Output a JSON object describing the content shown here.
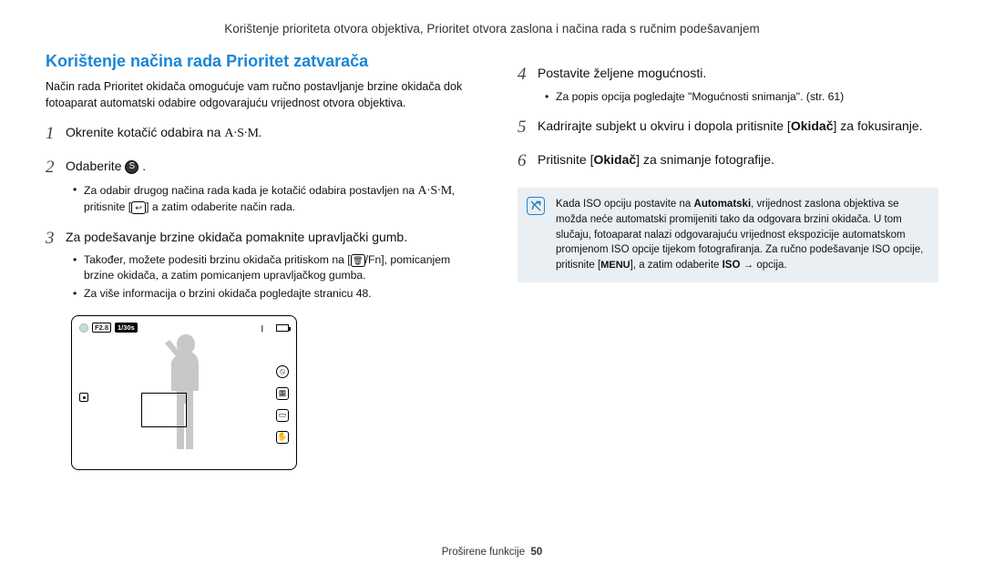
{
  "header": "Korištenje prioriteta otvora objektiva, Prioritet otvora zaslona i načina rada s ručnim podešavanjem",
  "section_title": "Korištenje načina rada Prioritet zatvarača",
  "intro": "Način rada Prioritet okidača omogućuje vam ručno postavljanje brzine okidača dok fotoaparat automatski odabire odgovarajuću vrijednost otvora objektiva.",
  "steps": {
    "s1_num": "1",
    "s1_text_a": "Okrenite kotačić odabira na ",
    "s1_mode": "A·S·M",
    "s1_text_b": ".",
    "s2_num": "2",
    "s2_text_a": "Odaberite ",
    "s2_icon_name": "s-mode-icon",
    "s2_text_b": ".",
    "s2_bullet_a": "Za odabir drugog načina rada kada je kotačić odabira postavljen na ",
    "s2_bullet_mode": "A·S·M",
    "s2_bullet_b": ", pritisnite [",
    "s2_bullet_icon": "back-icon",
    "s2_bullet_c": "] a zatim odaberite način rada.",
    "s3_num": "3",
    "s3_text": "Za podešavanje brzine okidača pomaknite upravljački gumb.",
    "s3_bullet1_a": "Također, možete podesiti brzinu okidača pritiskom na [",
    "s3_bullet1_icon": "trash-fn-icon",
    "s3_bullet1_b": "/Fn], pomicanjem brzine okidača, a zatim pomicanjem upravljačkog gumba.",
    "s3_bullet2": "Za više informacija o brzini okidača pogledajte stranicu 48.",
    "s4_num": "4",
    "s4_text": "Postavite željene mogućnosti.",
    "s4_bullet": "Za popis opcija pogledajte \"Mogućnosti snimanja\". (str. 61)",
    "s5_num": "5",
    "s5_text_a": "Kadrirajte subjekt u okviru i dopola pritisnite [",
    "s5_bold": "Okidač",
    "s5_text_b": "] za fokusiranje.",
    "s6_num": "6",
    "s6_text_a": "Pritisnite [",
    "s6_bold": "Okidač",
    "s6_text_b": "] za snimanje fotografije."
  },
  "diagram": {
    "aperture": "F2.8",
    "shutter": "1/30s",
    "tick": "|"
  },
  "note": {
    "text_a": "Kada ISO opciju postavite na ",
    "bold1": "Automatski",
    "text_b": ", vrijednost zaslona objektiva se možda neće automatski promijeniti tako da odgovara brzini okidača. U tom slučaju, fotoaparat nalazi odgovarajuću vrijednost ekspozicije automatskom promjenom ISO opcije tijekom fotografiranja. Za ručno podešavanje ISO opcije, pritisnite [",
    "menu": "MENU",
    "text_c": "], a zatim odaberite ",
    "bold2": "ISO",
    "arrow": " → ",
    "text_d": "opcija."
  },
  "footer": {
    "label": "Proširene funkcije",
    "page": "50"
  }
}
